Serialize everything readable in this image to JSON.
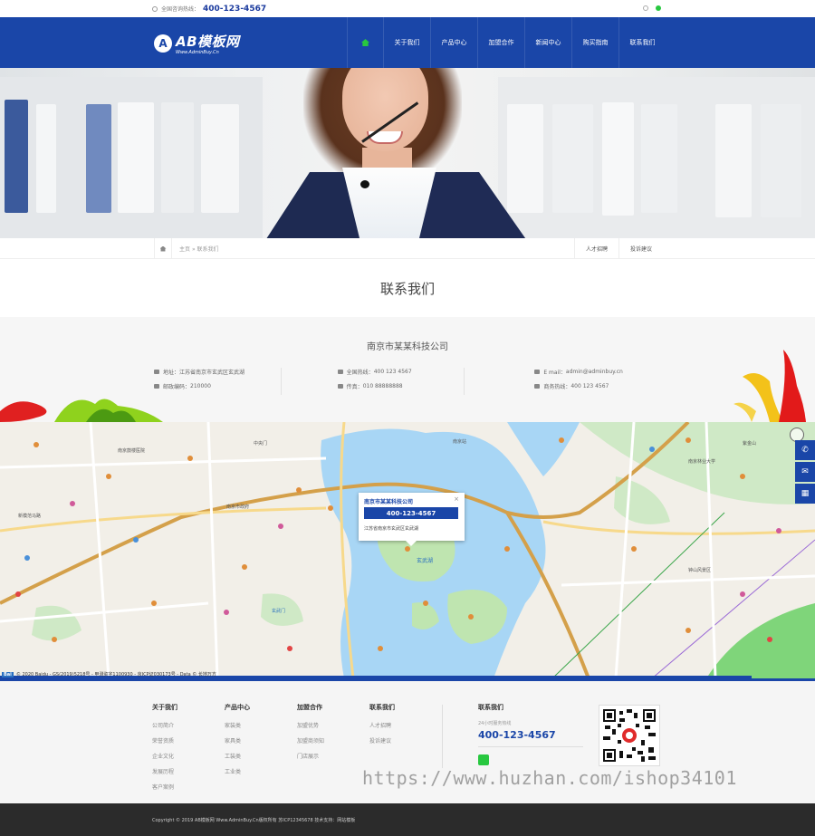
{
  "topbar": {
    "hotline_label": "全国咨询热线：",
    "hotline_number": "400-123-4567"
  },
  "logo": {
    "mark": "A",
    "name": "AB模板网",
    "url": "Www.AdminBuy.Cn"
  },
  "nav": {
    "items": [
      {
        "label": "关于我们"
      },
      {
        "label": "产品中心"
      },
      {
        "label": "加盟合作"
      },
      {
        "label": "新闻中心"
      },
      {
        "label": "购买指南"
      },
      {
        "label": "联系我们"
      }
    ]
  },
  "breadcrumb": {
    "home": "主页",
    "sep": "»",
    "current": "联系我们",
    "side_links": [
      "人才招聘",
      "投诉建议"
    ]
  },
  "page_title": "联系我们",
  "contact": {
    "company": "南京市某某科技公司",
    "address_label": "地址：",
    "address": "江苏省南京市玄武区玄武湖",
    "postcode_label": "邮政编码：",
    "postcode": "210000",
    "tel_label": "全国热线：",
    "tel": "400 123 4567",
    "fax_label": "传真：",
    "fax": "010 88888888",
    "email_label": "E mail：",
    "email": "admin@adminbuy.cn",
    "business_label": "商务热线：",
    "business": "400 123 4567"
  },
  "map": {
    "popup_name": "南京市某某科技公司",
    "popup_phone": "400-123-4567",
    "popup_address": "江苏省南京市玄武区玄武湖",
    "close": "×",
    "footer_text": "© 2020 Baidu - GS(2019)5218号 - 甲测资字1100930 - 京ICP证030173号 - Data © 长地万方",
    "baidu": "Bai",
    "labels": [
      "南京鼓楼医院",
      "玄武湖",
      "南京林业大学",
      "钟山风景区",
      "南京市政府",
      "新模范马路",
      "中央门",
      "紫金山",
      "南京站",
      "玄武门"
    ]
  },
  "float_buttons": [
    "phone-icon",
    "mail-icon",
    "qrcode-icon"
  ],
  "footer": {
    "cols": [
      {
        "title": "关于我们",
        "links": [
          "公司简介",
          "荣誉资质",
          "企业文化",
          "发展历程",
          "客户案例"
        ]
      },
      {
        "title": "产品中心",
        "links": [
          "家装类",
          "家具类",
          "工装类",
          "工业类"
        ]
      },
      {
        "title": "加盟合作",
        "links": [
          "加盟优势",
          "加盟商须知",
          "门店展示"
        ]
      },
      {
        "title": "联系我们",
        "links": [
          "人才招聘",
          "投诉建议"
        ]
      }
    ],
    "contact_title": "联系我们",
    "contact_sub": "24小时服务热线",
    "contact_phone": "400-123-4567"
  },
  "watermark": "https://www.huzhan.com/ishop34101",
  "copyright": "Copyright © 2019 AB模板网 Www.AdminBuy.Cn版权所有   苏ICP12345678   技术支持：网站模板",
  "colors": {
    "brand": "#1a46a8",
    "accent": "#28c840"
  }
}
